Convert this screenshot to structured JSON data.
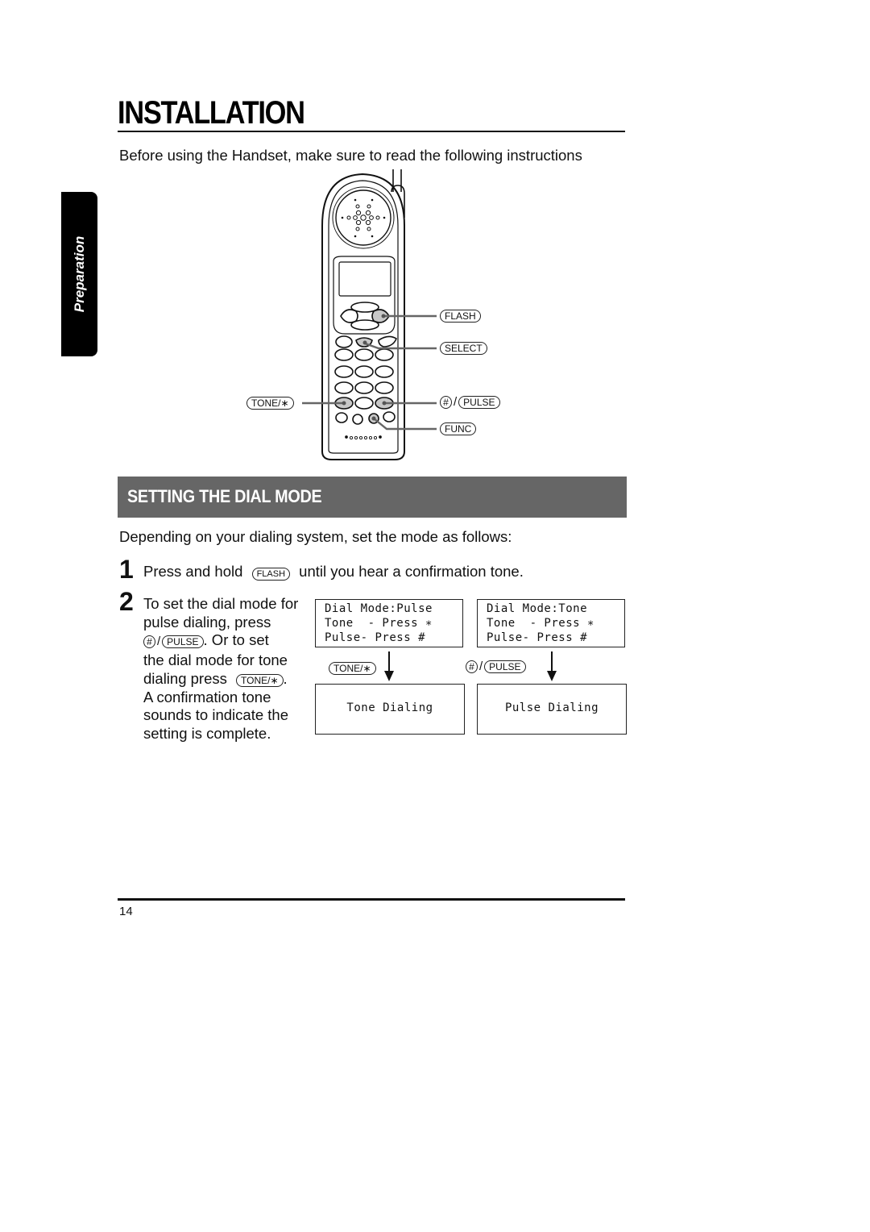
{
  "page": {
    "title": "INSTALLATION",
    "intro": "Before using the Handset, make sure to read the following instructions",
    "side_tab": "Preparation",
    "page_number": "14"
  },
  "handset_callouts": {
    "flash": "FLASH",
    "select": "SELECT",
    "tone": "TONE/∗",
    "hash": "#",
    "pulse": "PULSE",
    "func": "FUNC",
    "slash": "/"
  },
  "section": {
    "title": "SETTING THE DIAL MODE",
    "lead": "Depending on your dialing system, set the mode as follows:",
    "steps": [
      {
        "number": "1",
        "before": "Press and hold",
        "key": "FLASH",
        "after": "until you hear a confirmation tone."
      },
      {
        "number": "2",
        "line1": "To set the dial mode for",
        "line2": "pulse dialing, press",
        "key_hash": "#",
        "key_pulse": "PULSE",
        "line3_after": ". Or to set",
        "line4": "the dial mode for tone",
        "line5_before": "dialing press",
        "key_tone": "TONE/∗",
        "line5_after": ".",
        "line6": "A confirmation tone",
        "line7": "sounds to indicate the",
        "line8": "setting is complete."
      }
    ]
  },
  "displays": {
    "left": {
      "lines": [
        "Dial Mode:Pulse",
        "Tone  - Press ∗",
        "Pulse- Press #"
      ],
      "key": "TONE/∗",
      "result": "Tone Dialing"
    },
    "right": {
      "lines": [
        "Dial Mode:Tone",
        "Tone  - Press ∗",
        "Pulse- Press #"
      ],
      "key_hash": "#",
      "key_pulse": "PULSE",
      "result": "Pulse Dialing"
    }
  }
}
